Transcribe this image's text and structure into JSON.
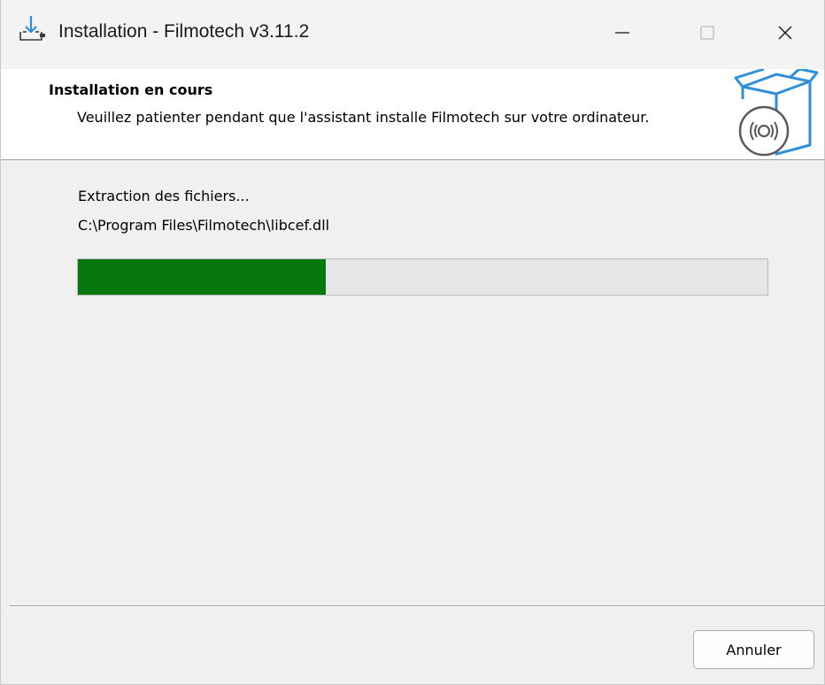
{
  "window": {
    "title": "Installation - Filmotech v3.11.2",
    "icon": "installer-download-icon",
    "controls": {
      "minimize_icon": "minimize-icon",
      "maximize_icon": "maximize-icon",
      "close_icon": "close-icon"
    }
  },
  "header": {
    "heading": "Installation en cours",
    "subheading": "Veuillez patienter pendant que l'assistant installe Filmotech sur votre ordinateur.",
    "graphic_icon": "software-box-disc-icon"
  },
  "body": {
    "status": "Extraction des fichiers...",
    "current_file": "C:\\Program Files\\Filmotech\\libcef.dll",
    "progress": {
      "fraction": 0.36,
      "color": "#06780f"
    }
  },
  "footer": {
    "cancel_label": "Annuler"
  },
  "colors": {
    "accent_blue": "#2f8fd8",
    "progress_green": "#06780f"
  }
}
